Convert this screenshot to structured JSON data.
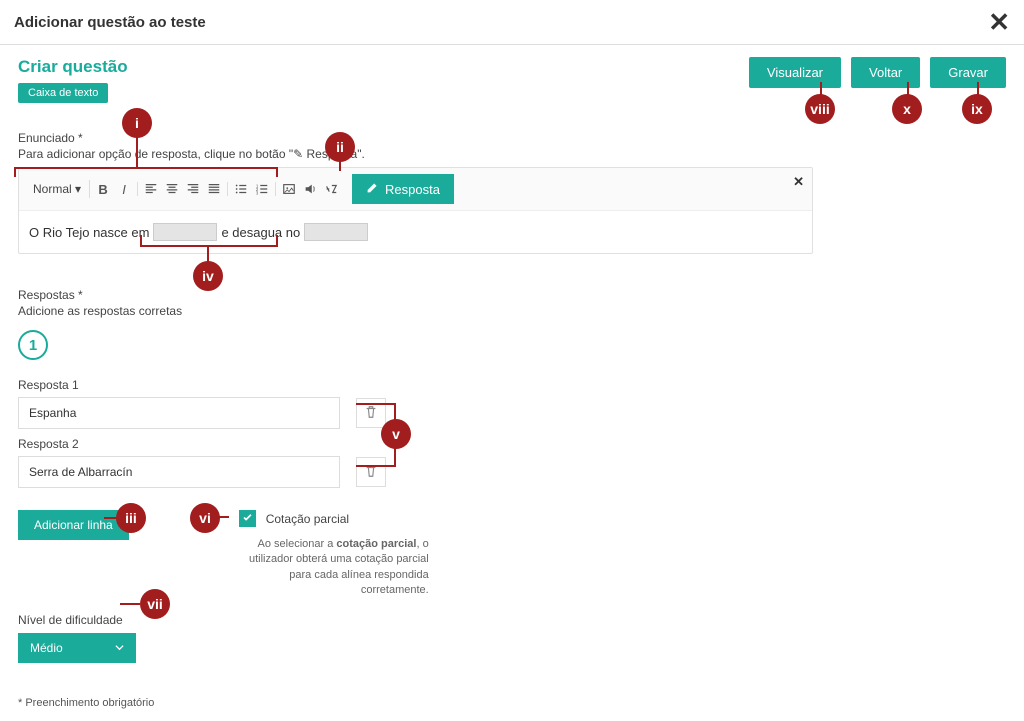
{
  "modal": {
    "title": "Adicionar questão ao teste",
    "close": "✕"
  },
  "header": {
    "create_title": "Criar questão",
    "type_pill": "Caixa de texto",
    "buttons": {
      "preview": "Visualizar",
      "back": "Voltar",
      "save": "Gravar"
    }
  },
  "statement": {
    "label": "Enunciado *",
    "sublabel_part1": "Para adicionar opção de resposta, clique no botão \"",
    "sublabel_part2": " Resposta\".",
    "toolbar": {
      "format_select": "Normal",
      "resposta_btn": "Resposta"
    },
    "body": {
      "part1": "O Rio Tejo nasce em",
      "part2": "e desagua no"
    }
  },
  "answers": {
    "label": "Respostas *",
    "sublabel": "Adicione as respostas corretas",
    "number": "1",
    "items": [
      {
        "label": "Resposta 1",
        "value": "Espanha"
      },
      {
        "label": "Resposta 2",
        "value": "Serra de Albarracín"
      }
    ],
    "add_btn": "Adicionar linha",
    "partial": {
      "label": "Cotação parcial",
      "desc_pre": "Ao selecionar a ",
      "desc_bold": "cotação parcial",
      "desc_post": ", o utilizador obterá uma cotação parcial para cada alínea respondida corretamente."
    }
  },
  "difficulty": {
    "label": "Nível de dificuldade",
    "value": "Médio"
  },
  "footnote": "* Preenchimento obrigatório",
  "callouts": {
    "i": "i",
    "ii": "ii",
    "iii": "iii",
    "iv": "iv",
    "v": "v",
    "vi": "vi",
    "vii": "vii",
    "viii": "viii",
    "ix": "ix",
    "x": "x"
  }
}
